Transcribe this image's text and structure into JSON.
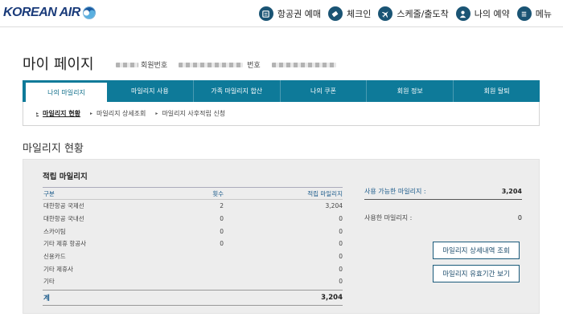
{
  "header": {
    "logo_text": "KOREAN AIR",
    "nav": [
      {
        "label": "항공권 예매",
        "icon": "ticket-icon"
      },
      {
        "label": "체크인",
        "icon": "boarding-pass-icon"
      },
      {
        "label": "스케줄/출도착",
        "icon": "airplane-icon"
      },
      {
        "label": "나의 예약",
        "icon": "person-icon"
      },
      {
        "label": "메뉴",
        "icon": "menu-icon"
      }
    ]
  },
  "page": {
    "title": "마이 페이지",
    "member_no_label": "회원번호",
    "number_label": "번호"
  },
  "tabs": [
    {
      "label": "나의 마일리지",
      "active": true
    },
    {
      "label": "마일리지 사용",
      "active": false
    },
    {
      "label": "가족 마일리지 합산",
      "active": false
    },
    {
      "label": "나의 쿠폰",
      "active": false
    },
    {
      "label": "회원 정보",
      "active": false
    },
    {
      "label": "회원 탈퇴",
      "active": false
    }
  ],
  "subtabs": [
    {
      "label": "마일리지 현황",
      "active": true
    },
    {
      "label": "마일리지 상세조회",
      "active": false
    },
    {
      "label": "마일리지 사후적립 신청",
      "active": false
    }
  ],
  "section": {
    "title": "마일리지 현황",
    "accrued_title": "적립 마일리지",
    "columns": [
      "구분",
      "횟수",
      "적립 마일리지"
    ],
    "rows": [
      [
        "대한항공 국제선",
        "2",
        "3,204"
      ],
      [
        "대한항공 국내선",
        "0",
        "0"
      ],
      [
        "스카이팀",
        "0",
        "0"
      ],
      [
        "기타 제휴 항공사",
        "0",
        "0"
      ],
      [
        "신용카드",
        "",
        "0"
      ],
      [
        "기타 제휴사",
        "",
        "0"
      ],
      [
        "기타",
        "",
        "0"
      ]
    ],
    "total_label": "계",
    "total_value": "3,204",
    "available_label": "사용 가능한 마일리지 :",
    "available_value": "3,204",
    "used_label": "사용한 마일리지 :",
    "used_value": "0",
    "btn_detail": "마일리지 상세내역 조회",
    "btn_validity": "마일리지 유효기간 보기"
  }
}
